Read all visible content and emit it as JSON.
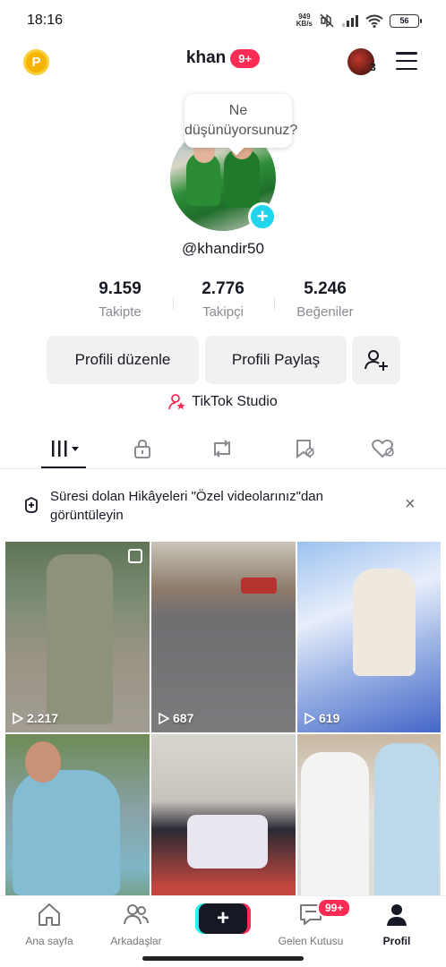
{
  "status_bar": {
    "time": "18:16",
    "net_speed_value": "949",
    "net_speed_unit": "KB/s",
    "battery": "56"
  },
  "header": {
    "coin_label": "P",
    "title": "khan",
    "badge": "9+",
    "avatar_count": "3"
  },
  "profile": {
    "bubble_text": "Ne düşünüyorsunuz?",
    "handle": "@khandir50",
    "stats": [
      {
        "value": "9.159",
        "label": "Takipte"
      },
      {
        "value": "2.776",
        "label": "Takipçi"
      },
      {
        "value": "5.246",
        "label": "Beğeniler"
      }
    ],
    "edit_button": "Profili düzenle",
    "share_button": "Profili Paylaş",
    "studio_label": "TikTok Studio"
  },
  "notice": {
    "text": "Süresi dolan Hikâyeleri \"Özel videolarınız\"dan görüntüleyin"
  },
  "videos": [
    {
      "views": "2.217"
    },
    {
      "views": "687"
    },
    {
      "views": "619"
    },
    {
      "views": ""
    },
    {
      "views": ""
    },
    {
      "views": ""
    }
  ],
  "bottom_nav": {
    "home": "Ana sayfa",
    "friends": "Arkadaşlar",
    "create": "+",
    "inbox": "Gelen Kutusu",
    "inbox_badge": "99+",
    "profile": "Profil"
  },
  "colors": {
    "accent": "#fe2c55",
    "cyan": "#20d5ec",
    "coin": "#f5b400"
  }
}
